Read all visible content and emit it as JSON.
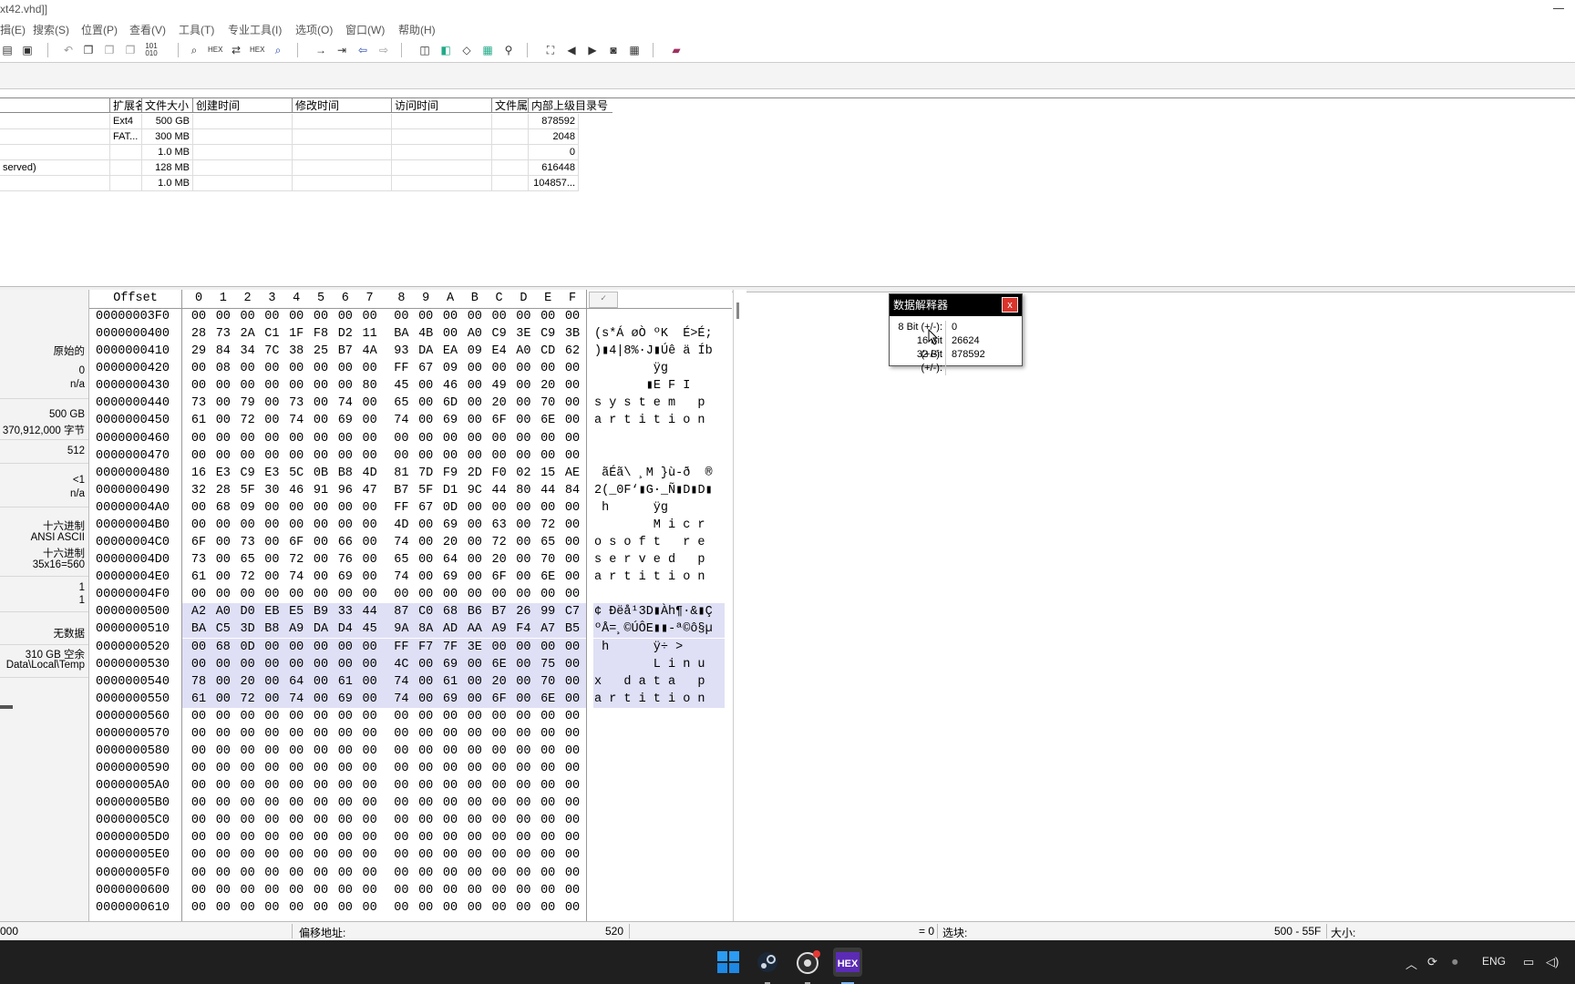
{
  "window": {
    "title": "xt42.vhd]]"
  },
  "menu": [
    "揖(E)",
    "搜索(S)",
    "位置(P)",
    "查看(V)",
    "工具(T)",
    "专业工具(I)",
    "选项(O)",
    "窗口(W)",
    "帮助(H)"
  ],
  "toolbar": {
    "icons": [
      "open-icon",
      "save-icon",
      "undo-icon",
      "copy-icon",
      "paste-icon",
      "paste-special-icon",
      "binary-icon",
      "find-icon",
      "find-hex-icon",
      "replace-icon",
      "replace-hex-icon",
      "find-next-icon",
      "goto-offset-icon",
      "goto-sector-icon",
      "back-icon",
      "forward-icon",
      "disk-icon",
      "clone-icon",
      "wipe-icon",
      "calculator-icon",
      "search-icon",
      "snapshot-icon",
      "prev-icon",
      "next-icon",
      "camera-icon",
      "table-icon",
      "book-icon"
    ]
  },
  "directory": {
    "columns": [
      "扩展名",
      "文件大小",
      "创建时间",
      "修改时间",
      "访问时间",
      "文件属性",
      "内部上级目录号"
    ],
    "rows": [
      {
        "name": "",
        "ext": "Ext4",
        "size": "500 GB",
        "created": "",
        "modified": "",
        "accessed": "",
        "attr": "",
        "parent": "878592"
      },
      {
        "name": "",
        "ext": "FAT...",
        "size": "300 MB",
        "created": "",
        "modified": "",
        "accessed": "",
        "attr": "",
        "parent": "2048"
      },
      {
        "name": "",
        "ext": "",
        "size": "1.0 MB",
        "created": "",
        "modified": "",
        "accessed": "",
        "attr": "",
        "parent": "0"
      },
      {
        "name": "served)",
        "ext": "",
        "size": "128 MB",
        "created": "",
        "modified": "",
        "accessed": "",
        "attr": "",
        "parent": "616448"
      },
      {
        "name": "",
        "ext": "",
        "size": "1.0 MB",
        "created": "",
        "modified": "",
        "accessed": "",
        "attr": "",
        "parent": "104857..."
      }
    ]
  },
  "infopanel": {
    "mode": "原始的",
    "v1": "0",
    "v2": "n/a",
    "size": "500 GB",
    "bytes": "370,912,000 字节",
    "sector": "512",
    "lt1": "<1",
    "na": "n/a",
    "hex": "十六进制",
    "ansi": "ANSI ASCII",
    "hex2": "十六进制",
    "dims": "35x16=560",
    "one_a": "1",
    "one_b": "1",
    "nodata": "无数据",
    "free": "310 GB 空余",
    "temp": "Data\\Local\\Temp"
  },
  "hex": {
    "offset_label": "Offset",
    "columns": [
      "0",
      "1",
      "2",
      "3",
      "4",
      "5",
      "6",
      "7",
      "8",
      "9",
      "A",
      "B",
      "C",
      "D",
      "E",
      "F"
    ],
    "rows": [
      {
        "off": "00000003F0",
        "bytes": [
          "00",
          "00",
          "00",
          "00",
          "00",
          "00",
          "00",
          "00",
          "00",
          "00",
          "00",
          "00",
          "00",
          "00",
          "00",
          "00"
        ],
        "text": "",
        "sel": false
      },
      {
        "off": "0000000400",
        "bytes": [
          "28",
          "73",
          "2A",
          "C1",
          "1F",
          "F8",
          "D2",
          "11",
          "BA",
          "4B",
          "00",
          "A0",
          "C9",
          "3E",
          "C9",
          "3B"
        ],
        "text": "(s*Á øÒ ºK  É>É;",
        "sel": false
      },
      {
        "off": "0000000410",
        "bytes": [
          "29",
          "84",
          "34",
          "7C",
          "38",
          "25",
          "B7",
          "4A",
          "93",
          "DA",
          "EA",
          "09",
          "E4",
          "A0",
          "CD",
          "62"
        ],
        "text": ")▮4|8%·J▮Úê ä Íb",
        "sel": false
      },
      {
        "off": "0000000420",
        "bytes": [
          "00",
          "08",
          "00",
          "00",
          "00",
          "00",
          "00",
          "00",
          "FF",
          "67",
          "09",
          "00",
          "00",
          "00",
          "00",
          "00"
        ],
        "text": "        ÿg",
        "sel": false
      },
      {
        "off": "0000000430",
        "bytes": [
          "00",
          "00",
          "00",
          "00",
          "00",
          "00",
          "00",
          "80",
          "45",
          "00",
          "46",
          "00",
          "49",
          "00",
          "20",
          "00"
        ],
        "text": "       ▮E F I",
        "sel": false
      },
      {
        "off": "0000000440",
        "bytes": [
          "73",
          "00",
          "79",
          "00",
          "73",
          "00",
          "74",
          "00",
          "65",
          "00",
          "6D",
          "00",
          "20",
          "00",
          "70",
          "00"
        ],
        "text": "s y s t e m   p",
        "sel": false
      },
      {
        "off": "0000000450",
        "bytes": [
          "61",
          "00",
          "72",
          "00",
          "74",
          "00",
          "69",
          "00",
          "74",
          "00",
          "69",
          "00",
          "6F",
          "00",
          "6E",
          "00"
        ],
        "text": "a r t i t i o n",
        "sel": false
      },
      {
        "off": "0000000460",
        "bytes": [
          "00",
          "00",
          "00",
          "00",
          "00",
          "00",
          "00",
          "00",
          "00",
          "00",
          "00",
          "00",
          "00",
          "00",
          "00",
          "00"
        ],
        "text": "",
        "sel": false
      },
      {
        "off": "0000000470",
        "bytes": [
          "00",
          "00",
          "00",
          "00",
          "00",
          "00",
          "00",
          "00",
          "00",
          "00",
          "00",
          "00",
          "00",
          "00",
          "00",
          "00"
        ],
        "text": "",
        "sel": false
      },
      {
        "off": "0000000480",
        "bytes": [
          "16",
          "E3",
          "C9",
          "E3",
          "5C",
          "0B",
          "B8",
          "4D",
          "81",
          "7D",
          "F9",
          "2D",
          "F0",
          "02",
          "15",
          "AE"
        ],
        "text": " ãÉã\\ ¸M }ù-ð  ®",
        "sel": false
      },
      {
        "off": "0000000490",
        "bytes": [
          "32",
          "28",
          "5F",
          "30",
          "46",
          "91",
          "96",
          "47",
          "B7",
          "5F",
          "D1",
          "9C",
          "44",
          "80",
          "44",
          "84"
        ],
        "text": "2(_0F‘▮G·_Ñ▮D▮D▮",
        "sel": false
      },
      {
        "off": "00000004A0",
        "bytes": [
          "00",
          "68",
          "09",
          "00",
          "00",
          "00",
          "00",
          "00",
          "FF",
          "67",
          "0D",
          "00",
          "00",
          "00",
          "00",
          "00"
        ],
        "text": " h      ÿg",
        "sel": false
      },
      {
        "off": "00000004B0",
        "bytes": [
          "00",
          "00",
          "00",
          "00",
          "00",
          "00",
          "00",
          "00",
          "4D",
          "00",
          "69",
          "00",
          "63",
          "00",
          "72",
          "00"
        ],
        "text": "        M i c r",
        "sel": false
      },
      {
        "off": "00000004C0",
        "bytes": [
          "6F",
          "00",
          "73",
          "00",
          "6F",
          "00",
          "66",
          "00",
          "74",
          "00",
          "20",
          "00",
          "72",
          "00",
          "65",
          "00"
        ],
        "text": "o s o f t   r e",
        "sel": false
      },
      {
        "off": "00000004D0",
        "bytes": [
          "73",
          "00",
          "65",
          "00",
          "72",
          "00",
          "76",
          "00",
          "65",
          "00",
          "64",
          "00",
          "20",
          "00",
          "70",
          "00"
        ],
        "text": "s e r v e d   p",
        "sel": false
      },
      {
        "off": "00000004E0",
        "bytes": [
          "61",
          "00",
          "72",
          "00",
          "74",
          "00",
          "69",
          "00",
          "74",
          "00",
          "69",
          "00",
          "6F",
          "00",
          "6E",
          "00"
        ],
        "text": "a r t i t i o n",
        "sel": false
      },
      {
        "off": "00000004F0",
        "bytes": [
          "00",
          "00",
          "00",
          "00",
          "00",
          "00",
          "00",
          "00",
          "00",
          "00",
          "00",
          "00",
          "00",
          "00",
          "00",
          "00"
        ],
        "text": "",
        "sel": false
      },
      {
        "off": "0000000500",
        "bytes": [
          "A2",
          "A0",
          "D0",
          "EB",
          "E5",
          "B9",
          "33",
          "44",
          "87",
          "C0",
          "68",
          "B6",
          "B7",
          "26",
          "99",
          "C7"
        ],
        "text": "¢ Ðëå¹3D▮Àh¶·&▮Ç",
        "sel": true
      },
      {
        "off": "0000000510",
        "bytes": [
          "BA",
          "C5",
          "3D",
          "B8",
          "A9",
          "DA",
          "D4",
          "45",
          "9A",
          "8A",
          "AD",
          "AA",
          "A9",
          "F4",
          "A7",
          "B5"
        ],
        "text": "ºÅ=¸©ÚÔE▮▮-ª©ô§µ",
        "sel": true
      },
      {
        "off": "0000000520",
        "bytes": [
          "00",
          "68",
          "0D",
          "00",
          "00",
          "00",
          "00",
          "00",
          "FF",
          "F7",
          "7F",
          "3E",
          "00",
          "00",
          "00",
          "00"
        ],
        "text": " h      ÿ÷ >",
        "sel": true
      },
      {
        "off": "0000000530",
        "bytes": [
          "00",
          "00",
          "00",
          "00",
          "00",
          "00",
          "00",
          "00",
          "4C",
          "00",
          "69",
          "00",
          "6E",
          "00",
          "75",
          "00"
        ],
        "text": "        L i n u",
        "sel": true
      },
      {
        "off": "0000000540",
        "bytes": [
          "78",
          "00",
          "20",
          "00",
          "64",
          "00",
          "61",
          "00",
          "74",
          "00",
          "61",
          "00",
          "20",
          "00",
          "70",
          "00"
        ],
        "text": "x   d a t a   p",
        "sel": true
      },
      {
        "off": "0000000550",
        "bytes": [
          "61",
          "00",
          "72",
          "00",
          "74",
          "00",
          "69",
          "00",
          "74",
          "00",
          "69",
          "00",
          "6F",
          "00",
          "6E",
          "00"
        ],
        "text": "a r t i t i o n",
        "sel": true
      },
      {
        "off": "0000000560",
        "bytes": [
          "00",
          "00",
          "00",
          "00",
          "00",
          "00",
          "00",
          "00",
          "00",
          "00",
          "00",
          "00",
          "00",
          "00",
          "00",
          "00"
        ],
        "text": "",
        "sel": false
      },
      {
        "off": "0000000570",
        "bytes": [
          "00",
          "00",
          "00",
          "00",
          "00",
          "00",
          "00",
          "00",
          "00",
          "00",
          "00",
          "00",
          "00",
          "00",
          "00",
          "00"
        ],
        "text": "",
        "sel": false
      },
      {
        "off": "0000000580",
        "bytes": [
          "00",
          "00",
          "00",
          "00",
          "00",
          "00",
          "00",
          "00",
          "00",
          "00",
          "00",
          "00",
          "00",
          "00",
          "00",
          "00"
        ],
        "text": "",
        "sel": false
      },
      {
        "off": "0000000590",
        "bytes": [
          "00",
          "00",
          "00",
          "00",
          "00",
          "00",
          "00",
          "00",
          "00",
          "00",
          "00",
          "00",
          "00",
          "00",
          "00",
          "00"
        ],
        "text": "",
        "sel": false
      },
      {
        "off": "00000005A0",
        "bytes": [
          "00",
          "00",
          "00",
          "00",
          "00",
          "00",
          "00",
          "00",
          "00",
          "00",
          "00",
          "00",
          "00",
          "00",
          "00",
          "00"
        ],
        "text": "",
        "sel": false
      },
      {
        "off": "00000005B0",
        "bytes": [
          "00",
          "00",
          "00",
          "00",
          "00",
          "00",
          "00",
          "00",
          "00",
          "00",
          "00",
          "00",
          "00",
          "00",
          "00",
          "00"
        ],
        "text": "",
        "sel": false
      },
      {
        "off": "00000005C0",
        "bytes": [
          "00",
          "00",
          "00",
          "00",
          "00",
          "00",
          "00",
          "00",
          "00",
          "00",
          "00",
          "00",
          "00",
          "00",
          "00",
          "00"
        ],
        "text": "",
        "sel": false
      },
      {
        "off": "00000005D0",
        "bytes": [
          "00",
          "00",
          "00",
          "00",
          "00",
          "00",
          "00",
          "00",
          "00",
          "00",
          "00",
          "00",
          "00",
          "00",
          "00",
          "00"
        ],
        "text": "",
        "sel": false
      },
      {
        "off": "00000005E0",
        "bytes": [
          "00",
          "00",
          "00",
          "00",
          "00",
          "00",
          "00",
          "00",
          "00",
          "00",
          "00",
          "00",
          "00",
          "00",
          "00",
          "00"
        ],
        "text": "",
        "sel": false
      },
      {
        "off": "00000005F0",
        "bytes": [
          "00",
          "00",
          "00",
          "00",
          "00",
          "00",
          "00",
          "00",
          "00",
          "00",
          "00",
          "00",
          "00",
          "00",
          "00",
          "00"
        ],
        "text": "",
        "sel": false
      },
      {
        "off": "0000000600",
        "bytes": [
          "00",
          "00",
          "00",
          "00",
          "00",
          "00",
          "00",
          "00",
          "00",
          "00",
          "00",
          "00",
          "00",
          "00",
          "00",
          "00"
        ],
        "text": "",
        "sel": false
      },
      {
        "off": "0000000610",
        "bytes": [
          "00",
          "00",
          "00",
          "00",
          "00",
          "00",
          "00",
          "00",
          "00",
          "00",
          "00",
          "00",
          "00",
          "00",
          "00",
          "00"
        ],
        "text": "",
        "sel": false
      }
    ]
  },
  "interpreter": {
    "title": "数据解释器",
    "close": "x",
    "rows": [
      {
        "label": "8 Bit (+/-):",
        "value": "0"
      },
      {
        "label": "16 Bit (+/-):",
        "value": "26624"
      },
      {
        "label": "32 Bit (+/-):",
        "value": "878592"
      }
    ]
  },
  "status": {
    "left": "000",
    "offset_label": "偏移地址:",
    "offset_value": "520",
    "eq": "= 0",
    "block_label": "选块:",
    "block_value": "500 - 55F",
    "size_label": "大小:"
  },
  "taskbar": {
    "apps": [
      "windows-start-icon",
      "steam-icon",
      "obs-icon",
      "winhex-icon"
    ],
    "lang": "ENG"
  },
  "colors": {
    "selection": "#dfe0f5",
    "interp_title": "#000000",
    "close": "#d9342b",
    "taskbar": "#1f1f1f"
  }
}
